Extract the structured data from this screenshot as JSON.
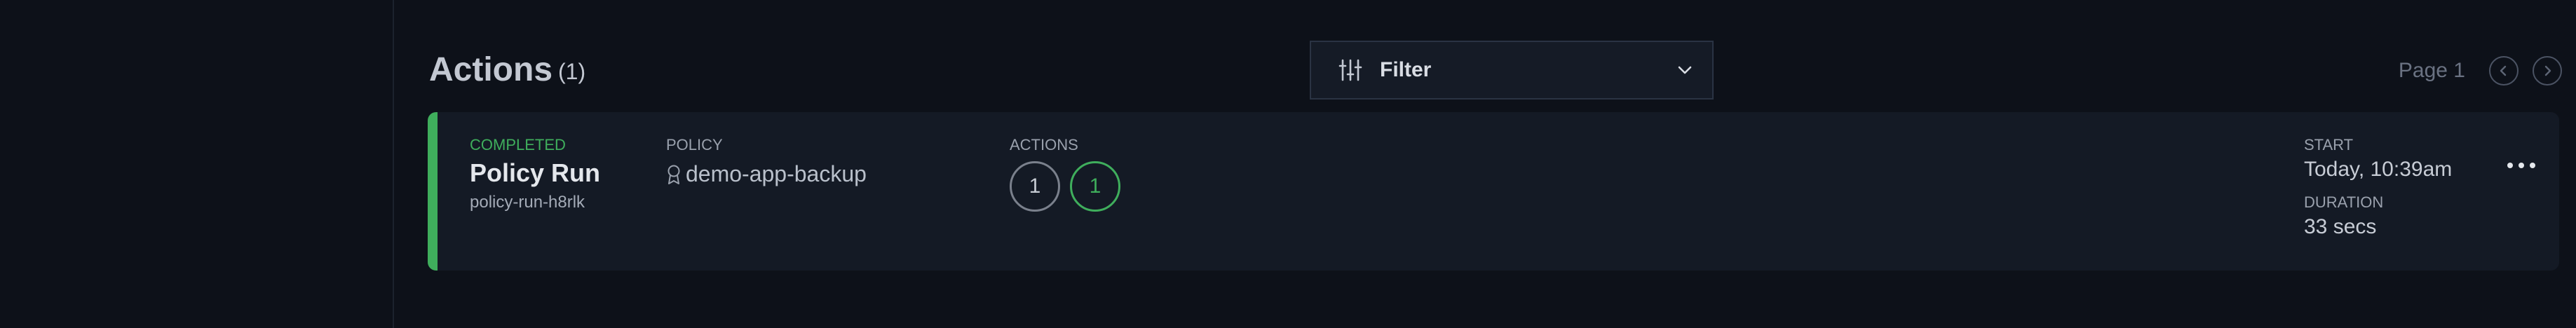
{
  "header": {
    "title": "Actions",
    "count": "(1)"
  },
  "filter": {
    "label": "Filter",
    "icon": "sliders-icon"
  },
  "pager": {
    "label": "Page 1"
  },
  "action_card": {
    "status": "COMPLETED",
    "run_type": "Policy Run",
    "run_id": "policy-run-h8rlk",
    "policy_label": "POLICY",
    "policy_name": "demo-app-backup",
    "actions_label": "ACTIONS",
    "action_counts": [
      "1",
      "1"
    ],
    "start_label": "START",
    "start_value": "Today, 10:39am",
    "duration_label": "DURATION",
    "duration_value": "33 secs"
  },
  "colors": {
    "background": "#0d1119",
    "card": "#141a25",
    "success": "#3fae5c"
  }
}
